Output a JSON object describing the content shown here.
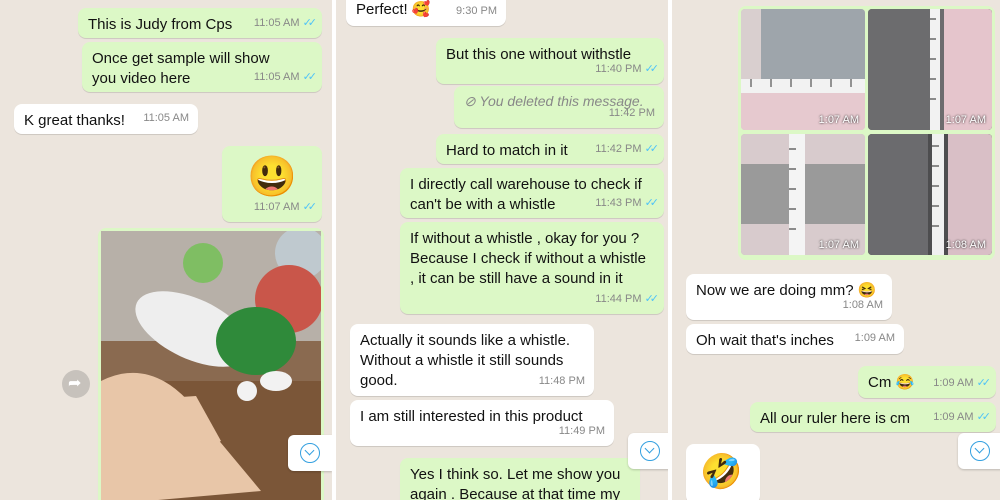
{
  "panel1": {
    "messages": [
      {
        "text": "This is Judy from Cps",
        "time": "11:05 AM"
      },
      {
        "text": "Once get sample will show you video here",
        "time": "11:05 AM"
      },
      {
        "text": "K great thanks!",
        "time": "11:05 AM"
      },
      {
        "text": "😃",
        "time": "11:07 AM"
      }
    ]
  },
  "panel2": {
    "messages": [
      {
        "text": "Perfect! 🥰",
        "time": "9:30 PM"
      },
      {
        "text": "But this one without withstle",
        "time": "11:40 PM"
      },
      {
        "text": "You deleted this message.",
        "time": "11:42 PM"
      },
      {
        "text": "Hard to match in it",
        "time": "11:42 PM"
      },
      {
        "text": "I directly call warehouse to check if can't be with a whistle",
        "time": "11:43 PM"
      },
      {
        "text": "If without a whistle , okay for you ? Because I check if without a whistle , it can be still have a sound in it",
        "time": "11:44 PM"
      },
      {
        "text": "Actually it sounds like a whistle. Without a whistle it still sounds good.",
        "time": "11:48 PM"
      },
      {
        "text": "I am still interested in this product",
        "time": "11:49 PM"
      },
      {
        "text": "Yes I think so. Let me show you again . Because at that time my",
        "time": ""
      }
    ]
  },
  "panel3": {
    "photos": [
      {
        "time": "1:07 AM"
      },
      {
        "time": "1:07 AM"
      },
      {
        "time": "1:07 AM"
      },
      {
        "time": "1:08 AM"
      }
    ],
    "messages": [
      {
        "text": "Now we are doing mm? 😆",
        "time": "1:08 AM"
      },
      {
        "text": "Oh wait that's inches",
        "time": "1:09 AM"
      },
      {
        "text": "Cm 😂",
        "time": "1:09 AM"
      },
      {
        "text": "All our ruler here is cm",
        "time": "1:09 AM"
      },
      {
        "text": "🤣",
        "time": ""
      }
    ]
  },
  "colors": {
    "outgoing": "#dcf8c6",
    "incoming": "#ffffff",
    "tick": "#4fc3f7",
    "background": "#ece5dd"
  },
  "icons": {
    "read_receipt": "double-check-icon",
    "scroll_down": "chevron-down-icon",
    "forward": "forward-icon",
    "deleted": "blocked-icon"
  }
}
